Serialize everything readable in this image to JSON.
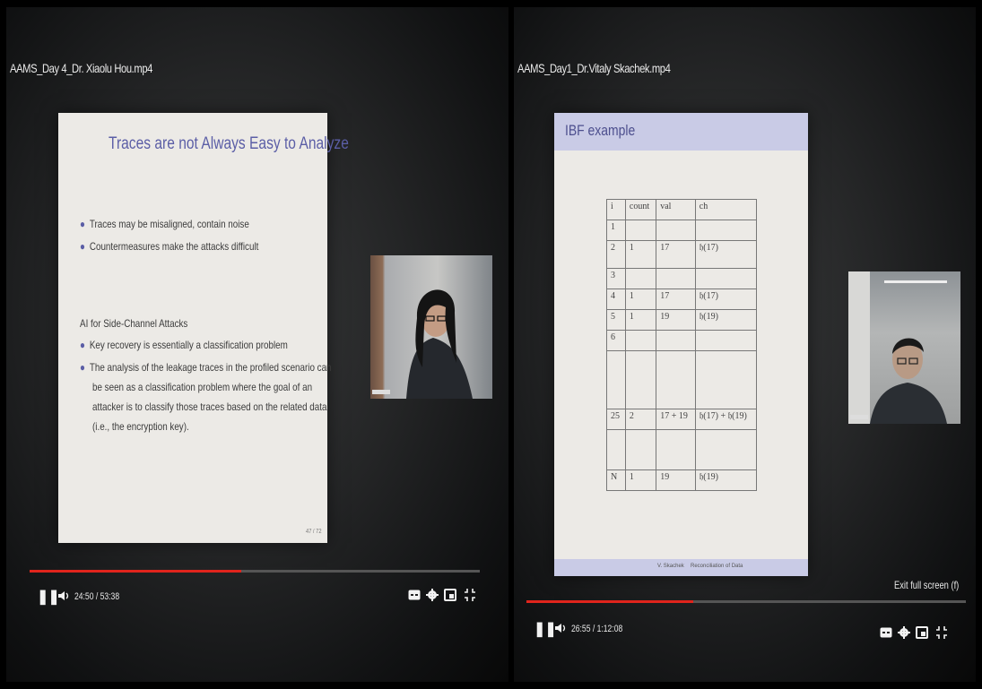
{
  "left": {
    "title": "AAMS_Day 4_Dr. Xiaolu Hou.mp4",
    "slide": {
      "heading": "Traces are not Always Easy to Analyze",
      "bullets_1": [
        "Traces may be misaligned, contain noise",
        "Countermeasures make the attacks difficult"
      ],
      "section": "AI for Side-Channel Attacks",
      "bullets_2": [
        "Key recovery is essentially a classification problem",
        "The analysis of the leakage traces in the profiled scenario can",
        "be seen as a classification problem where the goal of an",
        "attacker is to classify those traces based on the related data",
        "(i.e., the encryption key)."
      ],
      "page": "47 / 72"
    },
    "time": "24:50 / 53:38",
    "progress": 0.47
  },
  "right": {
    "title": "AAMS_Day1_Dr.Vitaly Skachek.mp4",
    "slide": {
      "heading": "IBF example",
      "table": {
        "headers": [
          "i",
          "count",
          "val",
          "ch"
        ],
        "rows": [
          [
            "1",
            "",
            "",
            ""
          ],
          [
            "2",
            "1",
            "17",
            "𝔥(17)"
          ],
          [
            "3",
            "",
            "",
            ""
          ],
          [
            "4",
            "1",
            "17",
            "𝔥(17)"
          ],
          [
            "5",
            "1",
            "19",
            "𝔥(19)"
          ],
          [
            "6",
            "",
            "",
            ""
          ],
          [
            "",
            "",
            "",
            ""
          ],
          [
            "25",
            "2",
            "17 + 19",
            "𝔥(17) + 𝔥(19)"
          ],
          [
            "",
            "",
            "",
            ""
          ],
          [
            "N",
            "1",
            "19",
            "𝔥(19)"
          ]
        ]
      },
      "footer_left": "V. Skachek",
      "footer_right": "Reconciliation of Data"
    },
    "time": "26:55 / 1:12:08",
    "progress": 0.38,
    "exit_fullscreen": "Exit full screen (f)"
  }
}
